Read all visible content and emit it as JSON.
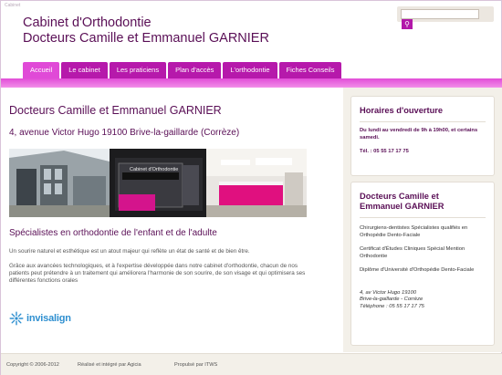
{
  "header": {
    "tiny_label": "Cabinet",
    "title_line1": "Cabinet d'Orthodontie",
    "title_line2": "Docteurs Camille et Emmanuel GARNIER",
    "search_placeholder": ""
  },
  "nav": {
    "tabs": [
      {
        "label": "Accueil",
        "active": true
      },
      {
        "label": "Le cabinet",
        "active": false
      },
      {
        "label": "Les praticiens",
        "active": false
      },
      {
        "label": "Plan d'accès",
        "active": false
      },
      {
        "label": "L'orthodontie",
        "active": false
      },
      {
        "label": "Fiches Conseils",
        "active": false
      }
    ]
  },
  "main": {
    "title": "Docteurs Camille et Emmanuel GARNIER",
    "address": "4, avenue Victor Hugo 19100 Brive-la-gaillarde (Corrèze)",
    "photo_sign": "Cabinet d'Orthodontie",
    "subheading": "Spécialistes en orthodontie de l'enfant et de l'adulte",
    "paragraph1": "Un sourire naturel et esthétique est un atout majeur qui reflète un état de santé et de bien être.",
    "paragraph2": "Grâce aux avancées technologiques, et à l'expertise développée dans notre cabinet d'orthodontie, chacun de nos patients peut prétendre à un traitement qui améliorera l'harmonie de son sourire, de son visage et qui optimisera ses différentes fonctions orales",
    "logo_text": "invisalign"
  },
  "sidebar": {
    "hours": {
      "title": "Horaires d'ouverture",
      "line": "Du lundi au vendredi de 9h à 19h00, et certains samedi.",
      "phone": "Tél. : 05 55 17 17 75"
    },
    "doctors": {
      "title_line1": "Docteurs Camille et",
      "title_line2": "Emmanuel GARNIER",
      "items": [
        "Chirurgiens-dentistes Spécialistes qualifiés en Orthopédie Dento-Faciale",
        "Certificat d'Études Cliniques Spécial Mention Orthodontie",
        "Diplôme d'Université d'Orthopédie Dento-Faciale"
      ],
      "address1": "4, av Victor Hugo 19100",
      "address2": "Brive-la-gaillarde - Corrèze",
      "phone": "Téléphone : 05 55 17 17 75"
    }
  },
  "footer": {
    "copyright": "Copyright © 2006-2012",
    "made_by": "Réalisé et intégré par Agicia",
    "powered_by": "Propulsé par ITWS"
  },
  "colors": {
    "brand_purple": "#5a0f56",
    "tab_magenta": "#b619ab",
    "bar_magenta": "#e14dd7",
    "sidebar_bg": "#f3f0e9"
  }
}
